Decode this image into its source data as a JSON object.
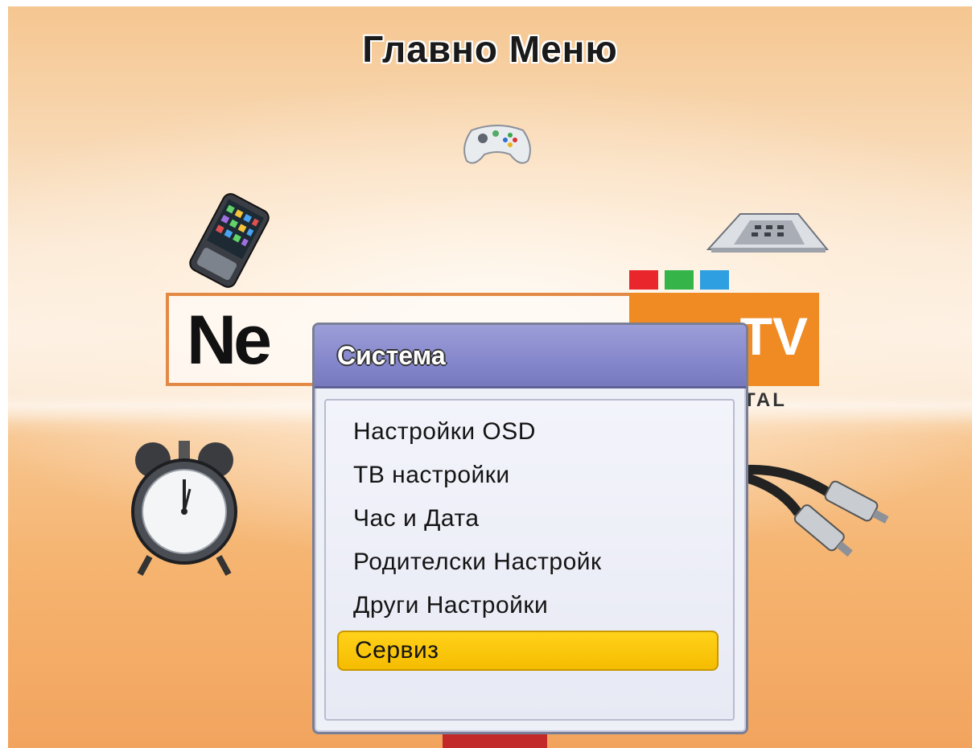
{
  "screen": {
    "title": "Главно Меню"
  },
  "logo": {
    "brand_text": "Ne",
    "tv_text": "TV",
    "tagline": "TAL",
    "square_colors": [
      "#e8262c",
      "#35b44a",
      "#2e9fe0"
    ]
  },
  "icons": {
    "top": "gamepad-icon",
    "left": "mobile-phone-icon",
    "right": "desk-phone-icon",
    "bottom_left": "alarm-clock-icon",
    "bottom_right": "rca-cable-icon"
  },
  "dialog": {
    "title": "Система",
    "items": [
      {
        "label": "Настройки OSD"
      },
      {
        "label": "ТВ настройки"
      },
      {
        "label": "Час и Дата"
      },
      {
        "label": "Родителски Настройк"
      },
      {
        "label": "Други Настройки"
      },
      {
        "label": "Сервиз",
        "selected": true
      }
    ]
  },
  "colors": {
    "highlight": "#f5bc00",
    "header": "#8587cc",
    "background": "#f8d8b3"
  }
}
